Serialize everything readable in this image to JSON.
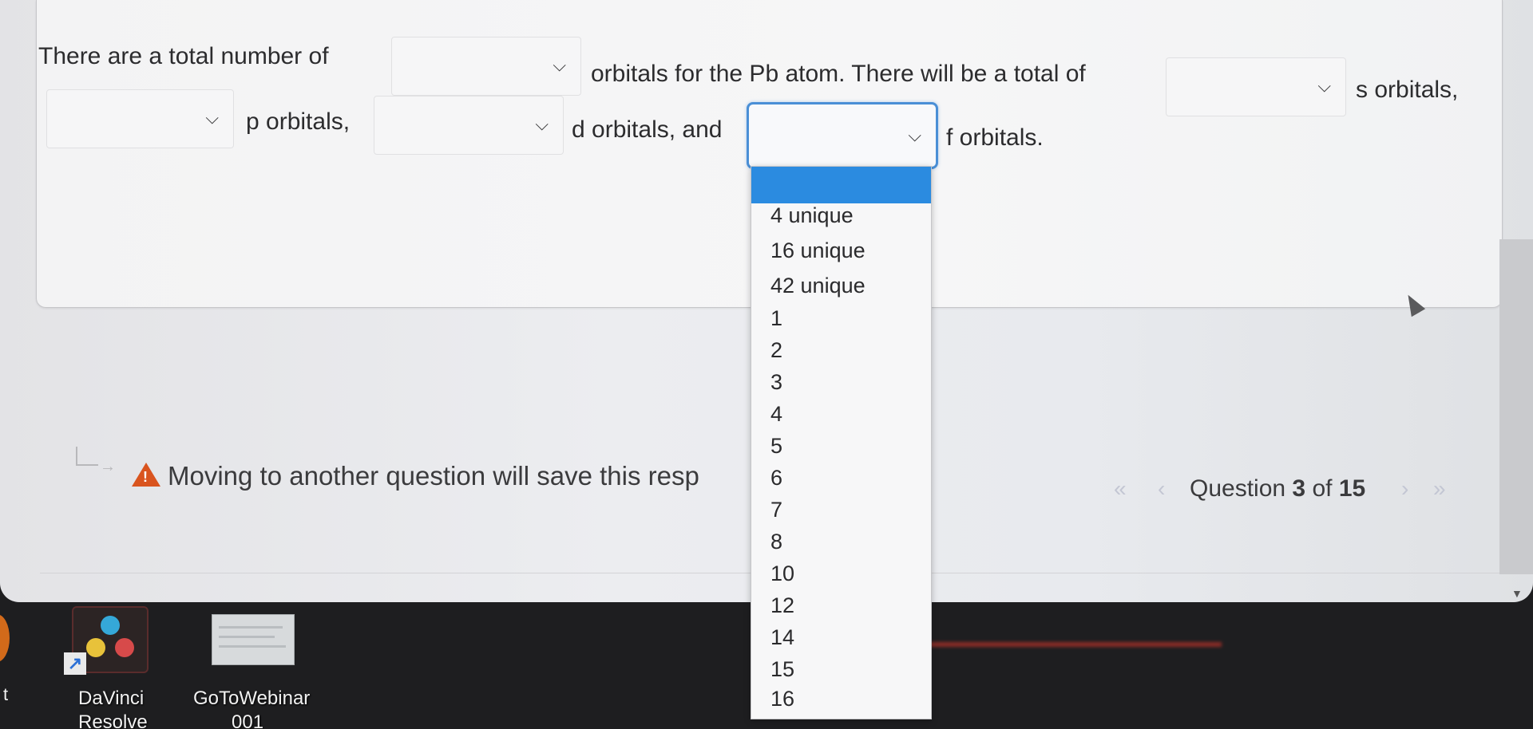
{
  "question": {
    "segment_1": "There are a total number of",
    "segment_2": "orbitals for the Pb atom. There will be a total of",
    "segment_3": "s orbitals,",
    "segment_4": "p orbitals,",
    "segment_5": "d orbitals, and",
    "segment_6": "f orbitals."
  },
  "selects": {
    "total_orbitals": {
      "value": "",
      "icon": "chevron-down-icon"
    },
    "s_orbitals": {
      "value": "",
      "icon": "chevron-down-icon"
    },
    "p_orbitals": {
      "value": "",
      "icon": "chevron-down-icon"
    },
    "d_orbitals": {
      "value": "",
      "icon": "chevron-down-icon"
    },
    "f_orbitals": {
      "value": "",
      "icon": "chevron-down-icon"
    }
  },
  "dropdown": {
    "highlighted_option": "",
    "options": [
      "4 unique",
      "16 unique",
      "42 unique",
      "1",
      "2",
      "3",
      "4",
      "5",
      "6",
      "7",
      "8",
      "10",
      "12",
      "14",
      "15",
      "16"
    ]
  },
  "warning": {
    "text": "Moving to another question will save this resp",
    "icon": "warning-triangle-icon"
  },
  "pager": {
    "first_icon": "«",
    "prev_icon": "‹",
    "label_prefix": "Question",
    "current": "3",
    "label_of": "of",
    "total": "15",
    "next_icon": "›",
    "last_icon": "»"
  },
  "desktop": {
    "icons": [
      {
        "label_line1": "DaVinci",
        "label_line2": "Resolve",
        "icon": "davinci-resolve-icon"
      },
      {
        "label_line1": "GoToWebinar",
        "label_line2": "001",
        "icon": "gotowebinar-icon"
      }
    ],
    "left_edge_label": "t"
  },
  "colors": {
    "highlight": "#2b8be0",
    "focus_border": "#4a8fd6",
    "warning": "#d9541e"
  }
}
